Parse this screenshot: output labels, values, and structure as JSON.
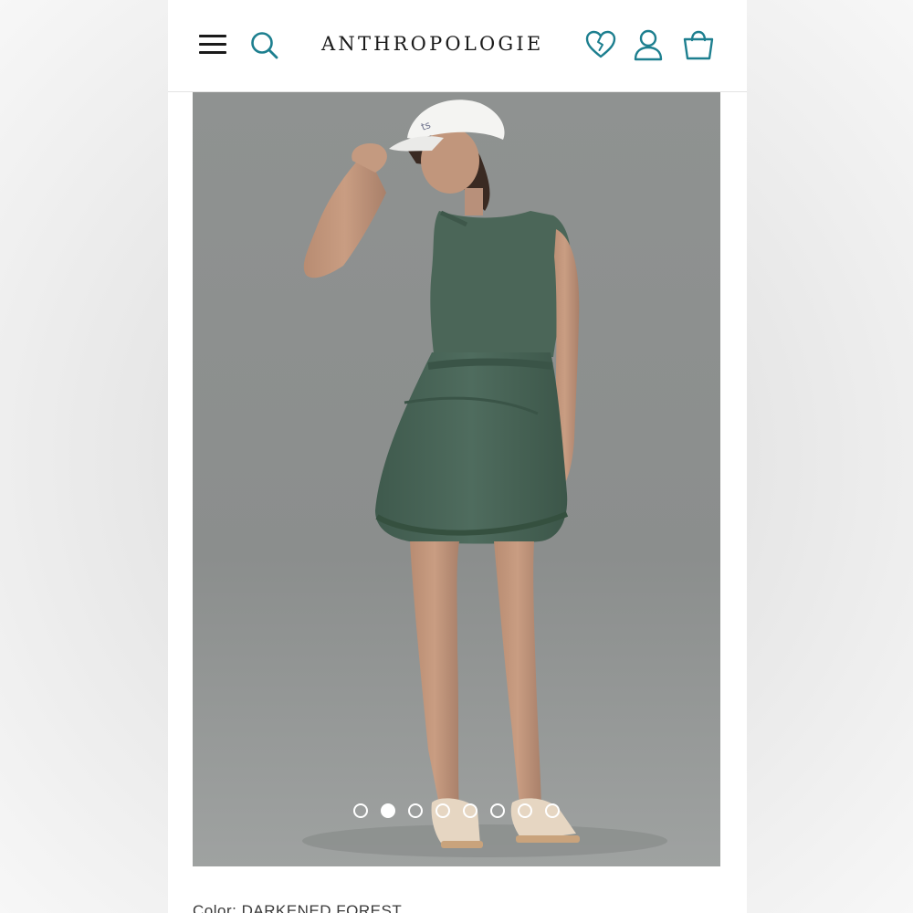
{
  "header": {
    "logo_text": "ANTHROPOLOGIE",
    "accent_color": "#1d7f8f",
    "icons": [
      "menu-icon",
      "search-icon",
      "heart-icon",
      "user-icon",
      "shopping-bag-icon"
    ]
  },
  "gallery": {
    "slide_count": 8,
    "active_slide": 2,
    "dot_labels": [
      "1",
      "2",
      "3",
      "4",
      "5",
      "6",
      "7",
      "8"
    ]
  },
  "product": {
    "color_label": "Color:",
    "color_value": "DARKENED FOREST"
  }
}
